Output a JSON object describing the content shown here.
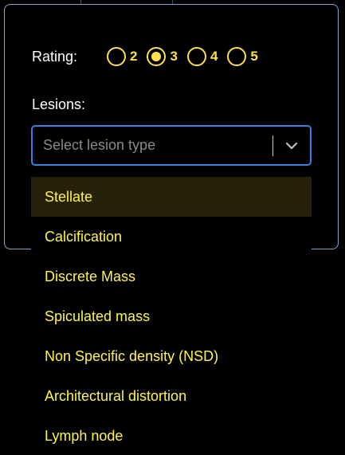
{
  "rating": {
    "label": "Rating:",
    "options": [
      "2",
      "3",
      "4",
      "5"
    ],
    "selected": "3"
  },
  "lesions": {
    "label": "Lesions:",
    "placeholder": "Select lesion type",
    "options": [
      "Stellate",
      "Calcification",
      "Discrete Mass",
      "Spiculated mass",
      "Non Specific density (NSD)",
      "Architectural distortion",
      "Lymph node"
    ],
    "highlighted": "Stellate"
  },
  "colors": {
    "accent": "#ffe14d",
    "focus_border": "#3d7fe0",
    "panel_border": "#8aa3c8",
    "highlight_bg": "#27210a"
  }
}
